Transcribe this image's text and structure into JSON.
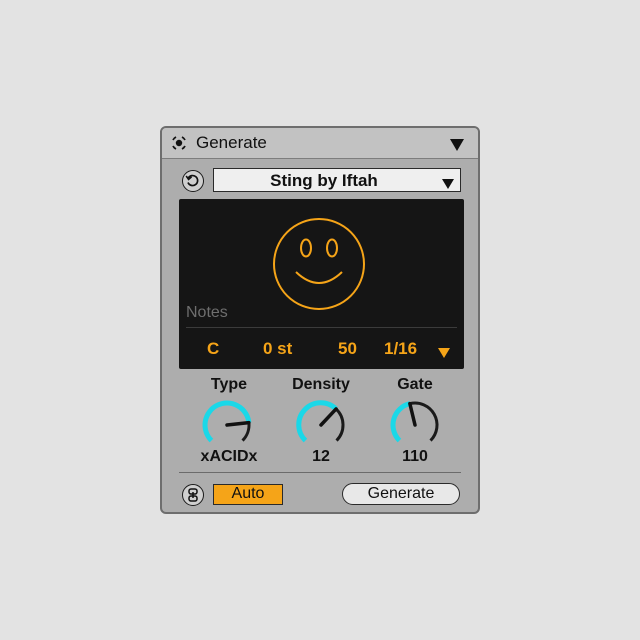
{
  "device": {
    "title": "Generate",
    "preset": "Sting by Iftah"
  },
  "display": {
    "notes_label": "Notes",
    "key": "C",
    "transpose": "0 st",
    "velocity": "50",
    "rate": "1/16"
  },
  "controls": [
    {
      "label": "Type",
      "value": "xACIDx",
      "level": 0.81
    },
    {
      "label": "Density",
      "value": "12",
      "level": 0.66
    },
    {
      "label": "Gate",
      "value": "110",
      "level": 0.45
    }
  ],
  "bottom": {
    "auto_label": "Auto",
    "generate_label": "Generate"
  },
  "colors": {
    "accent": "#f5a418",
    "knob_arc": "#1ad8e8",
    "panel": "#adadad",
    "display": "#151515"
  },
  "icons": {
    "title": "device-activator-icon",
    "collapse": "triangle-down-icon",
    "reset": "reset-circular-icon",
    "face": "smiley-face-icon",
    "link": "link-chain-icon"
  }
}
